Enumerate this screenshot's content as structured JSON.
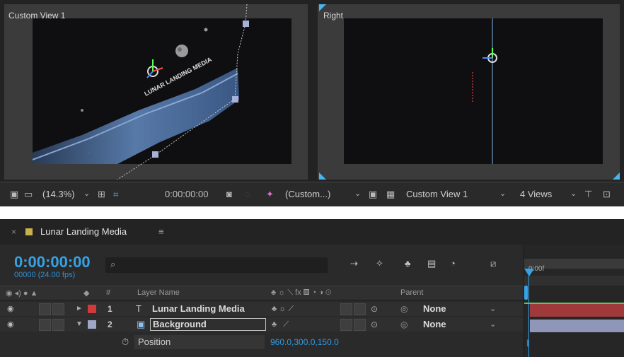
{
  "viewer": {
    "left_view": "Custom View 1",
    "right_view": "Right",
    "toolbar": {
      "zoom": "(14.3%)",
      "timecode": "0:00:00:00",
      "camera": "(Custom...)",
      "active_view": "Custom View 1",
      "layout": "4 Views"
    },
    "scene_text": "LUNAR LANDING MEDIA"
  },
  "timeline": {
    "tab_close": "×",
    "tab_title": "Lunar Landing Media",
    "tab_menu": "≡",
    "timecode": "0:00:00:00",
    "frames": "00000 (24.00 fps)",
    "search_placeholder": "",
    "ruler_start": "0:00f",
    "headers": {
      "hash": "#",
      "layer_name": "Layer Name",
      "parent": "Parent"
    },
    "layers": [
      {
        "number": "1",
        "type_glyph": "T",
        "name": "Lunar Landing Media",
        "parent": "None",
        "label_color": "#d23a3a",
        "bar_color": "#a03a3a"
      },
      {
        "number": "2",
        "type_glyph": "▣",
        "name": "Background",
        "parent": "None",
        "label_color": "#9fa7c9",
        "bar_color": "#8f97b8"
      }
    ],
    "property": {
      "name": "Position",
      "value": "960.0,300.0,150.0"
    }
  }
}
